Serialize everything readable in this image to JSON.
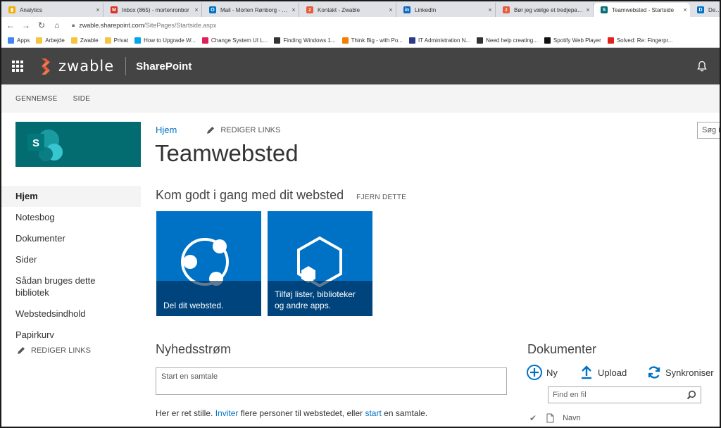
{
  "browser": {
    "tabs": [
      {
        "title": "Analytics",
        "icon": "analytics-icon",
        "color": "#f9ab00",
        "glyph": "▮"
      },
      {
        "title": "Inbox (865) - mortenronbor",
        "icon": "gmail-icon",
        "color": "#d93025",
        "glyph": "M"
      },
      {
        "title": "Mail - Morten Rønborg - Ou",
        "icon": "outlook-icon",
        "color": "#0072c6",
        "glyph": "O"
      },
      {
        "title": "Kontakt - Zwable",
        "icon": "zwable-icon",
        "color": "#e85a3a",
        "glyph": "z"
      },
      {
        "title": "LinkedIn",
        "icon": "linkedin-icon",
        "color": "#0a66c2",
        "glyph": "in"
      },
      {
        "title": "Bør jeg vælge et tredjepartsv",
        "icon": "zwable-icon",
        "color": "#e85a3a",
        "glyph": "z"
      },
      {
        "title": "Teamwebsted - Startside",
        "icon": "sharepoint-icon",
        "color": "#036c70",
        "glyph": "S"
      },
      {
        "title": "Delve",
        "icon": "delve-icon",
        "color": "#0072c6",
        "glyph": "D"
      }
    ],
    "close_glyph": "×",
    "url_host": "zwable.sharepoint.com",
    "url_path": "/SitePages/Startside.aspx",
    "bookmarks": [
      {
        "label": "Apps",
        "icon": "apps-grid-icon",
        "color": "#4285f4"
      },
      {
        "label": "Arbejde",
        "icon": "folder-icon",
        "color": "#f5c542"
      },
      {
        "label": "Zwable",
        "icon": "folder-icon",
        "color": "#f5c542"
      },
      {
        "label": "Privat",
        "icon": "folder-icon",
        "color": "#f5c542"
      },
      {
        "label": "How to Upgrade W...",
        "icon": "windows-icon",
        "color": "#00a4ef"
      },
      {
        "label": "Change System UI L...",
        "icon": "slack-icon",
        "color": "#e01e5a"
      },
      {
        "label": "Finding Windows 1...",
        "icon": "tn-icon",
        "color": "#333333"
      },
      {
        "label": "Think Big - with Po...",
        "icon": "blogger-icon",
        "color": "#f57d00"
      },
      {
        "label": "IT Administration N...",
        "icon": "four-icon",
        "color": "#2b3a8c"
      },
      {
        "label": "Need help creating...",
        "icon": "tn-icon",
        "color": "#333333"
      },
      {
        "label": "Spotify Web Player",
        "icon": "spotify-icon",
        "color": "#111111"
      },
      {
        "label": "Solved: Re: Fingerpr...",
        "icon": "lenovo-icon",
        "color": "#e2231a"
      }
    ]
  },
  "suite": {
    "brand": "zwable",
    "app": "SharePoint",
    "accent": "#e85a3a",
    "bg": "#444444"
  },
  "ribbon": {
    "items": [
      "GENNEMSE",
      "SIDE"
    ]
  },
  "left_nav": {
    "items": [
      "Hjem",
      "Notesbog",
      "Dokumenter",
      "Sider",
      "Sådan bruges dette bibliotek",
      "Webstedsindhold",
      "Papirkurv"
    ],
    "edit_links": "REDIGER LINKS"
  },
  "main": {
    "breadcrumb_home": "Hjem",
    "edit_links": "REDIGER LINKS",
    "search_placeholder": "Søg i",
    "title": "Teamwebsted",
    "get_started": "Kom godt i gang med dit websted",
    "remove": "FJERN DETTE",
    "tiles": [
      {
        "caption": "Del dit websted.",
        "icon": "share-icon"
      },
      {
        "caption": "Tilføj lister, biblioteker og andre apps.",
        "icon": "add-apps-icon"
      }
    ],
    "newsfeed": {
      "heading": "Nyhedsstrøm",
      "placeholder": "Start en samtale",
      "quiet_pre": "Her er ret stille. ",
      "invite": "Inviter",
      "quiet_mid": " flere personer til webstedet, eller ",
      "start": "start",
      "quiet_post": " en samtale."
    },
    "documents": {
      "heading": "Dokumenter",
      "new": "Ny",
      "upload": "Upload",
      "sync": "Synkroniser",
      "find_placeholder": "Find en fil",
      "col_name": "Navn"
    }
  }
}
